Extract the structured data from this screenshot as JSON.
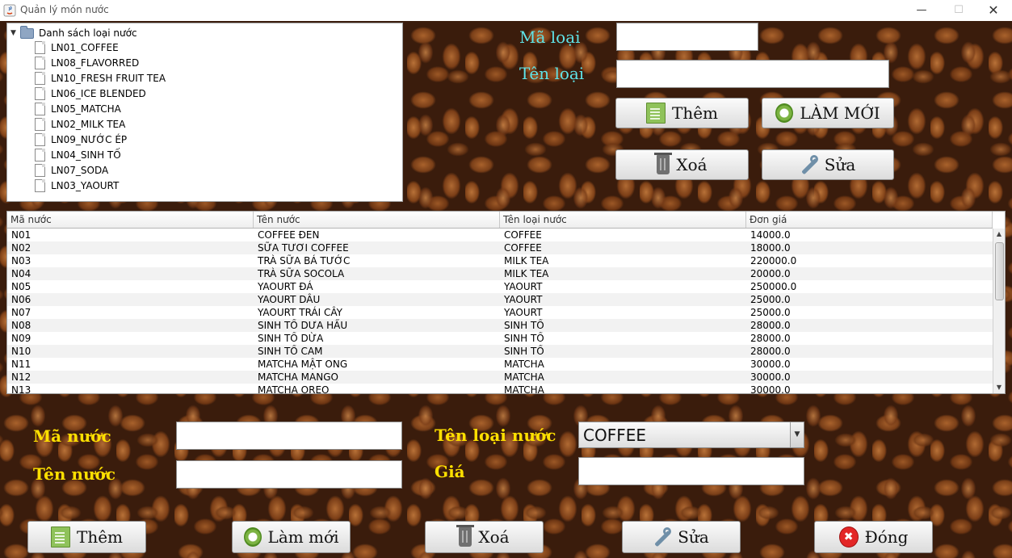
{
  "window": {
    "title": "Quản lý món nước"
  },
  "tree": {
    "root": "Danh sách loại nước",
    "items": [
      "LN01_COFFEE",
      "LN08_FLAVORRED",
      "LN10_FRESH FRUIT TEA",
      "LN06_ICE BLENDED",
      "LN05_MATCHA",
      "LN02_MILK TEA",
      "LN09_NƯỚC ÉP",
      "LN04_SINH TỐ",
      "LN07_SODA",
      "LN03_YAOURT"
    ]
  },
  "category_form": {
    "ma_loai_label": "Mã loại",
    "ten_loai_label": "Tên loại",
    "ma_loai_value": "",
    "ten_loai_value": "",
    "add_label": "Thêm",
    "refresh_label": "LÀM MỚI",
    "delete_label": "Xoá",
    "edit_label": "Sửa"
  },
  "table": {
    "columns": [
      "Mã nước",
      "Tên nước",
      "Tên loại nước",
      "Đơn giá"
    ],
    "rows": [
      [
        "N01",
        "COFFEE ĐEN",
        "COFFEE",
        "14000.0"
      ],
      [
        "N02",
        "SỮA TƯƠI COFFEE",
        "COFFEE",
        "18000.0"
      ],
      [
        "N03",
        "TRÀ SỮA BÁ TƯỚC",
        "MILK TEA",
        "220000.0"
      ],
      [
        "N04",
        "TRÀ SỮA SOCOLA",
        "MILK TEA",
        "20000.0"
      ],
      [
        "N05",
        "YAOURT ĐÁ",
        "YAOURT",
        "250000.0"
      ],
      [
        "N06",
        "YAOURT DÂU",
        "YAOURT",
        "25000.0"
      ],
      [
        "N07",
        "YAOURT TRÁI CÂY",
        "YAOURT",
        "25000.0"
      ],
      [
        "N08",
        "SINH TỐ DƯA HẤU",
        "SINH TỐ",
        "28000.0"
      ],
      [
        "N09",
        "SINH TỐ DỪA",
        "SINH TỐ",
        "28000.0"
      ],
      [
        "N10",
        "SINH TỐ CAM",
        "SINH TỐ",
        "28000.0"
      ],
      [
        "N11",
        "MATCHA MẬT ONG",
        "MATCHA",
        "30000.0"
      ],
      [
        "N12",
        "MATCHA MANGO",
        "MATCHA",
        "30000.0"
      ],
      [
        "N13",
        "MATCHA OREO",
        "MATCHA",
        "30000.0"
      ]
    ]
  },
  "drink_form": {
    "ma_nuoc_label": "Mã nước",
    "ten_nuoc_label": "Tên nước",
    "ten_loai_nuoc_label": "Tên loại nước",
    "gia_label": "Giá",
    "ma_nuoc_value": "",
    "ten_nuoc_value": "",
    "gia_value": "",
    "loai_selected": "COFFEE"
  },
  "bottom_buttons": {
    "add_label": "Thêm",
    "refresh_label": "Làm mới",
    "delete_label": "Xoá",
    "edit_label": "Sửa",
    "close_label": "Đóng"
  },
  "colors": {
    "cyan_label": "#5fe3e8",
    "yellow_label": "#ffe000",
    "background": "#3a1c0c"
  }
}
